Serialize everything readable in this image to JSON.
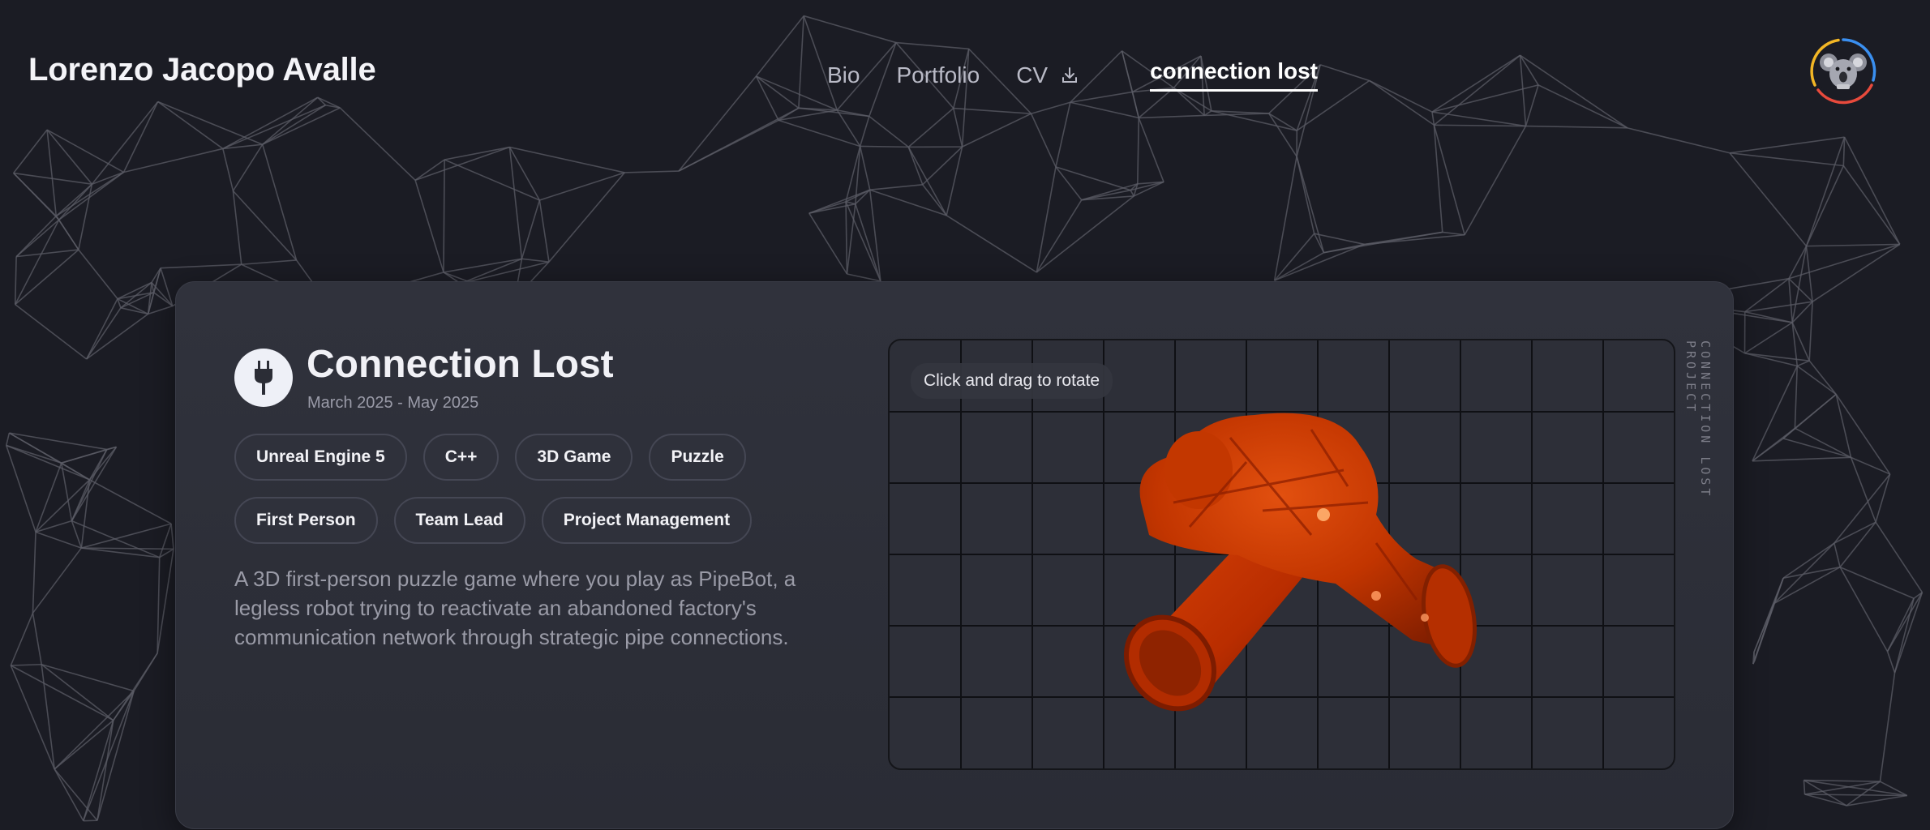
{
  "header": {
    "site_title": "Lorenzo Jacopo Avalle",
    "avatar_icon": "koala-avatar-icon"
  },
  "nav": {
    "items": [
      {
        "label": "Bio"
      },
      {
        "label": "Portfolio"
      },
      {
        "label": "CV",
        "icon": "download-icon"
      },
      {
        "label": "connection lost",
        "active": true
      }
    ]
  },
  "project": {
    "icon": "plug-icon",
    "title": "Connection Lost",
    "dates": "March 2025 - May 2025",
    "tags": [
      "Unreal Engine 5",
      "C++",
      "3D Game",
      "Puzzle",
      "First Person",
      "Team Lead",
      "Project Management"
    ],
    "description": "A 3D first-person puzzle game where you play as PipeBot, a legless robot trying to reactivate an abandoned factory's communication network through strategic pipe connections."
  },
  "viewer": {
    "hint": "Click and drag to rotate",
    "model": "red-pipe-model",
    "side_label": "CONNECTION LOST PROJECT"
  },
  "colors": {
    "background": "#1b1c24",
    "card": "#2d2f38",
    "pipe": "#c43000",
    "avatar_ring": [
      "#3a8ff0",
      "#e84a3c",
      "#f2b625"
    ]
  }
}
